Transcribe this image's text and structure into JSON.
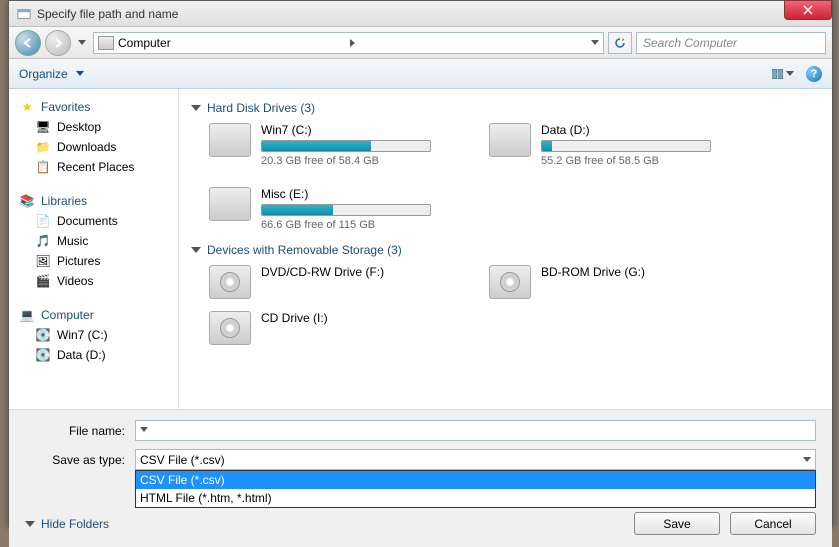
{
  "title": "Specify file path and name",
  "breadcrumb": {
    "root": "Computer"
  },
  "search_placeholder": "Search Computer",
  "toolbar": {
    "organize": "Organize"
  },
  "sidebar": {
    "favorites": {
      "label": "Favorites",
      "items": [
        "Desktop",
        "Downloads",
        "Recent Places"
      ]
    },
    "libraries": {
      "label": "Libraries",
      "items": [
        "Documents",
        "Music",
        "Pictures",
        "Videos"
      ]
    },
    "computer": {
      "label": "Computer",
      "items": [
        "Win7 (C:)",
        "Data (D:)"
      ]
    }
  },
  "sections": {
    "hdd": {
      "title": "Hard Disk Drives (3)",
      "drives": [
        {
          "name": "Win7 (C:)",
          "free": "20.3 GB free of 58.4 GB",
          "pct": 65
        },
        {
          "name": "Data (D:)",
          "free": "55.2 GB free of 58.5 GB",
          "pct": 6
        },
        {
          "name": "Misc (E:)",
          "free": "66.6 GB free of 115 GB",
          "pct": 42
        }
      ]
    },
    "removable": {
      "title": "Devices with Removable Storage (3)",
      "drives": [
        {
          "name": "DVD/CD-RW Drive (F:)"
        },
        {
          "name": "BD-ROM Drive (G:)"
        },
        {
          "name": "CD Drive (I:)"
        }
      ]
    }
  },
  "footer": {
    "filename_label": "File name:",
    "filename_value": "",
    "saveas_label": "Save as type:",
    "saveas_value": "CSV File (*.csv)",
    "options": [
      "CSV File (*.csv)",
      "HTML File (*.htm, *.html)"
    ],
    "hide_folders": "Hide Folders",
    "save": "Save",
    "cancel": "Cancel"
  }
}
